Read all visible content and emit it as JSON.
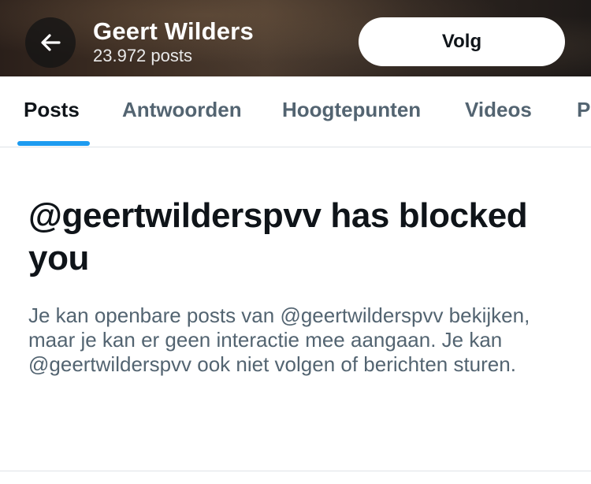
{
  "header": {
    "back_icon": "arrow-left-icon",
    "name": "Geert Wilders",
    "post_count": "23.972 posts",
    "follow_label": "Volg"
  },
  "tabs": [
    {
      "label": "Posts",
      "active": true
    },
    {
      "label": "Antwoorden",
      "active": false
    },
    {
      "label": "Hoogtepunten",
      "active": false
    },
    {
      "label": "Videos",
      "active": false
    },
    {
      "label": "P",
      "active": false
    }
  ],
  "main": {
    "title": "@geertwilderspvv has blocked you",
    "description": "Je kan openbare posts van @geertwilderspvv bekijken, maar je kan er geen interactie mee aangaan. Je kan @geertwilderspvv ook niet volgen of berichten sturen."
  },
  "colors": {
    "accent": "#1d9bf0",
    "text_primary": "#0f1419",
    "text_secondary": "#536471"
  }
}
